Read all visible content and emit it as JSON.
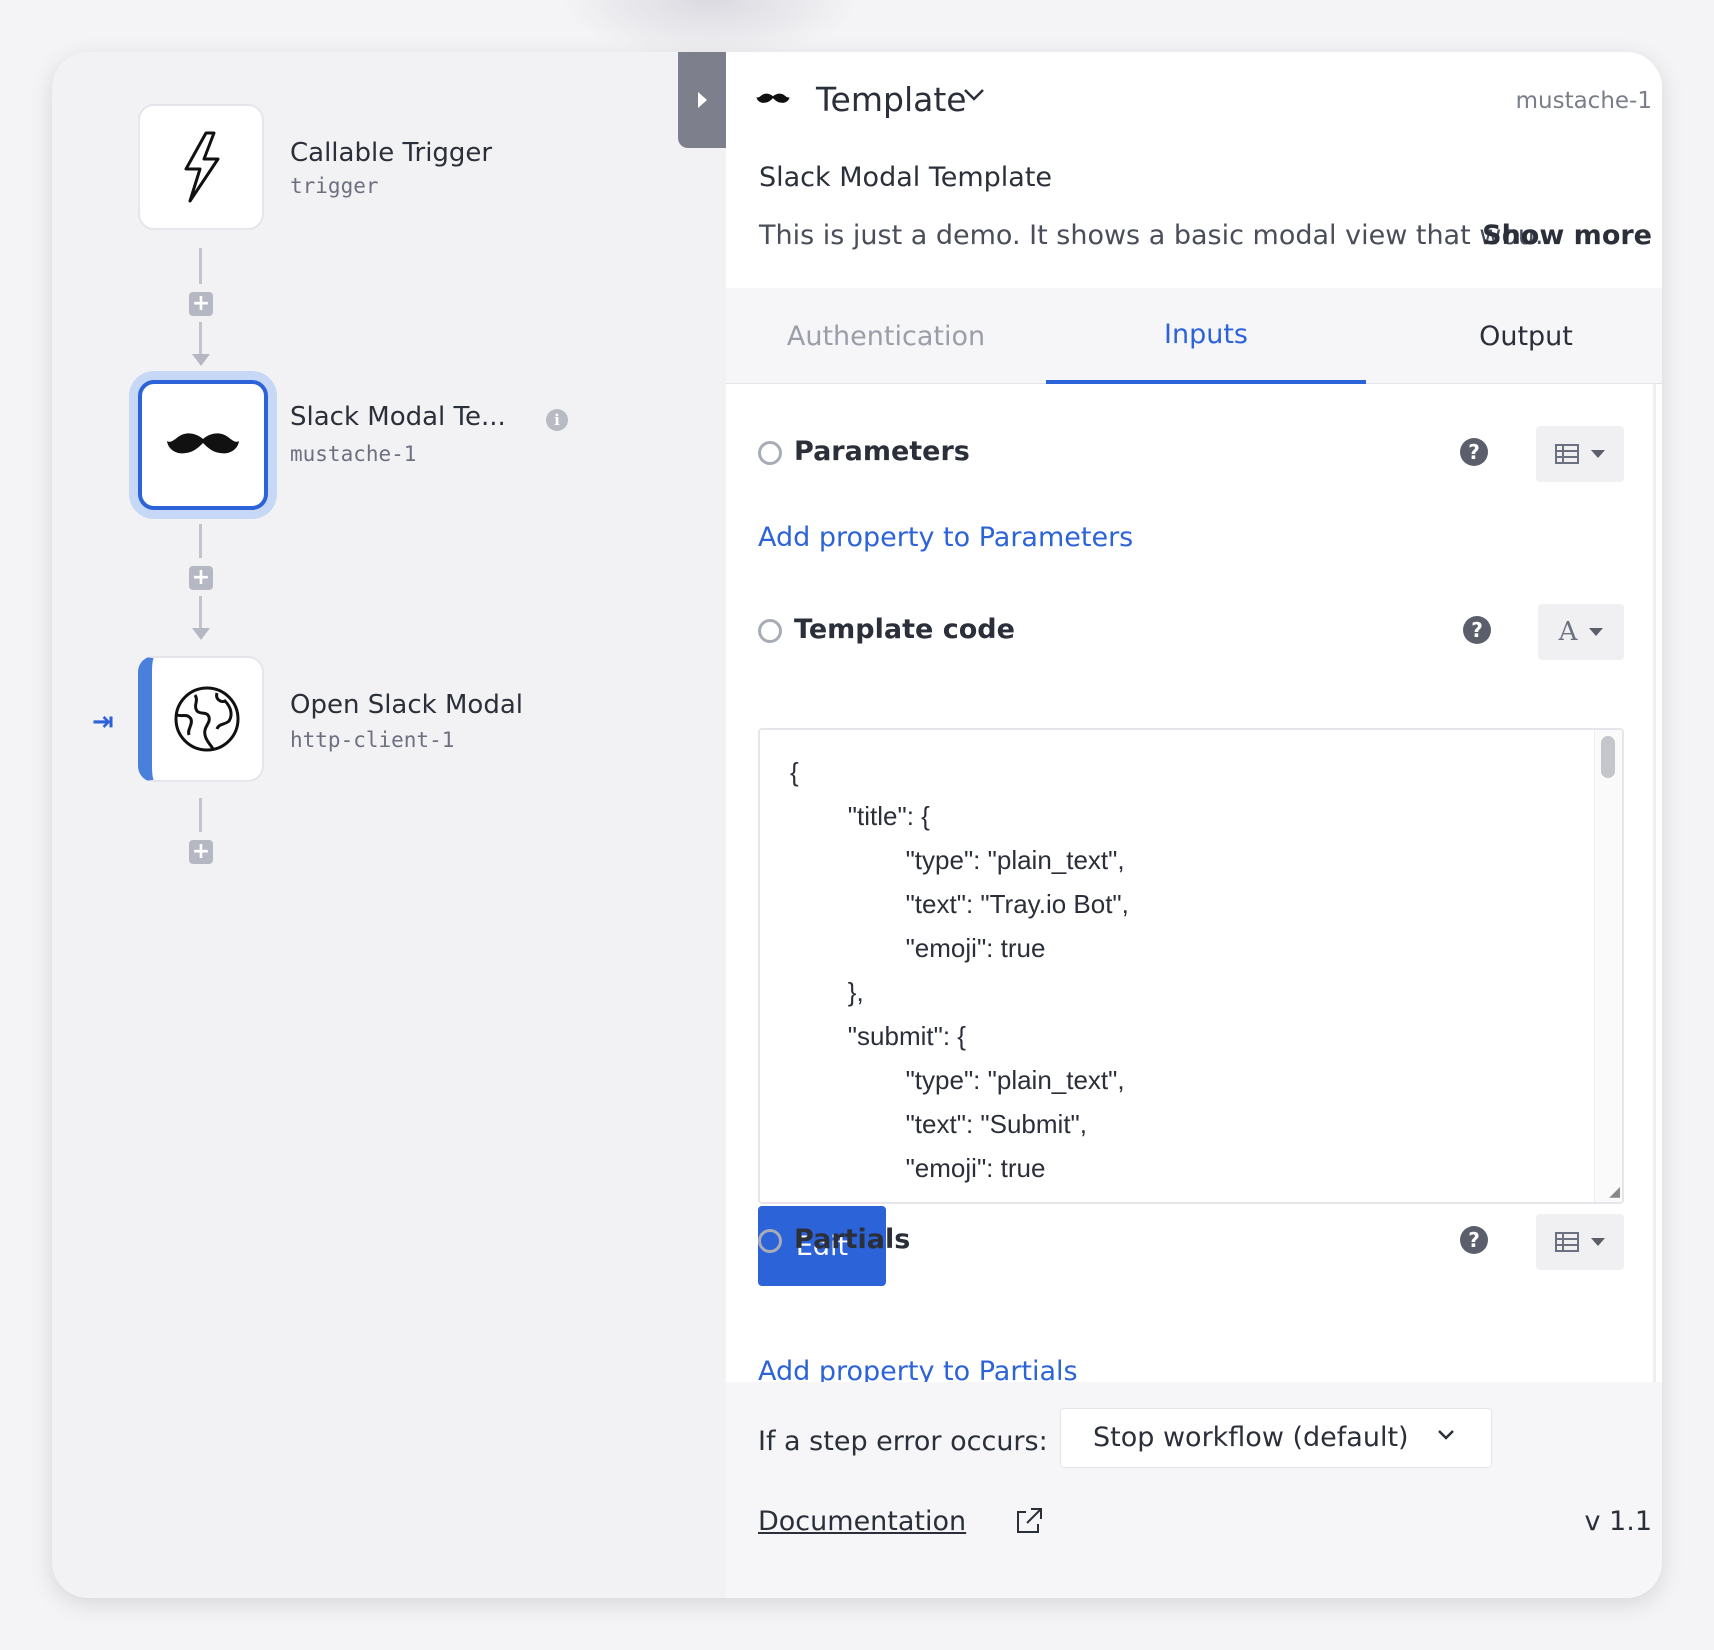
{
  "workflow": {
    "steps": [
      {
        "title": "Callable Trigger",
        "subtitle": "trigger",
        "icon": "lightning-icon"
      },
      {
        "title": "Slack Modal Te...",
        "subtitle": "mustache-1",
        "icon": "mustache-icon",
        "selected": true
      },
      {
        "title": "Open Slack Modal",
        "subtitle": "http-client-1",
        "icon": "globe-icon"
      }
    ]
  },
  "panel": {
    "connector_type": "Template",
    "step_id": "mustache-1",
    "step_name": "Slack Modal Template",
    "description": "This is just a demo. It shows a basic modal view that wou...",
    "show_more": "Show more",
    "tabs": [
      {
        "label": "Authentication",
        "active": false
      },
      {
        "label": "Inputs",
        "active": true
      },
      {
        "label": "Output",
        "active": false
      }
    ],
    "fields": {
      "parameters": {
        "label": "Parameters",
        "add_link": "Add property to Parameters"
      },
      "template_code": {
        "label": "Template code",
        "type_glyph": "A",
        "code": "{\n        \"title\": {\n                \"type\": \"plain_text\",\n                \"text\": \"Tray.io Bot\",\n                \"emoji\": true\n        },\n        \"submit\": {\n                \"type\": \"plain_text\",\n                \"text\": \"Submit\",\n                \"emoji\": true\n        },",
        "edit_label": "Edit"
      },
      "partials": {
        "label": "Partials",
        "add_link": "Add property to Partials"
      }
    },
    "footer": {
      "error_label": "If a step error occurs:",
      "error_option": "Stop workflow (default)",
      "documentation": "Documentation",
      "version": "v 1.1"
    }
  },
  "colors": {
    "accent": "#2d63d9",
    "selected_ring": "#c6d8f5"
  }
}
